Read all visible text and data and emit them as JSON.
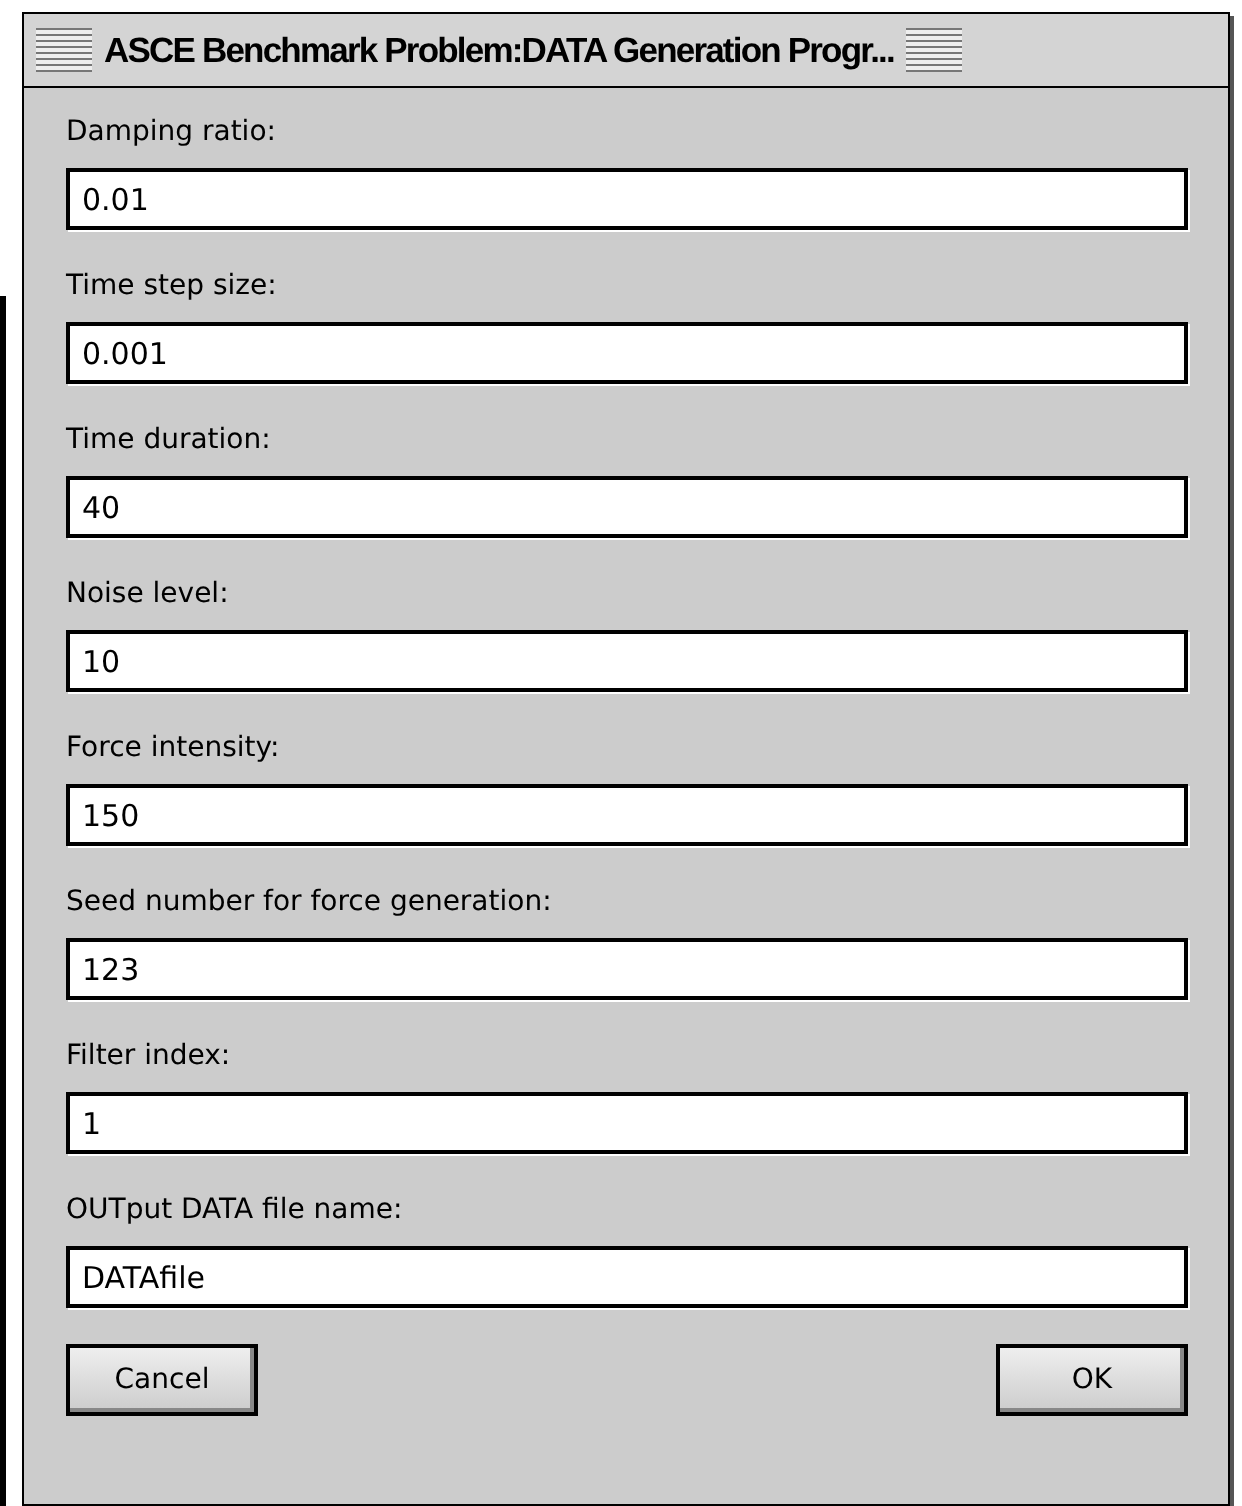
{
  "window": {
    "title": "ASCE Benchmark Problem:DATA Generation Progr..."
  },
  "fields": [
    {
      "label": "Damping ratio:",
      "value": "0.01"
    },
    {
      "label": "Time step size:",
      "value": "0.001"
    },
    {
      "label": "Time duration:",
      "value": "40"
    },
    {
      "label": "Noise level:",
      "value": "10"
    },
    {
      "label": "Force intensity:",
      "value": "150"
    },
    {
      "label": "Seed number for force generation:",
      "value": "123"
    },
    {
      "label": "Filter index:",
      "value": "1"
    },
    {
      "label": "OUTput DATA file name:",
      "value": "DATAfile"
    }
  ],
  "buttons": [
    {
      "label": "Cancel"
    },
    {
      "label": "OK"
    }
  ]
}
